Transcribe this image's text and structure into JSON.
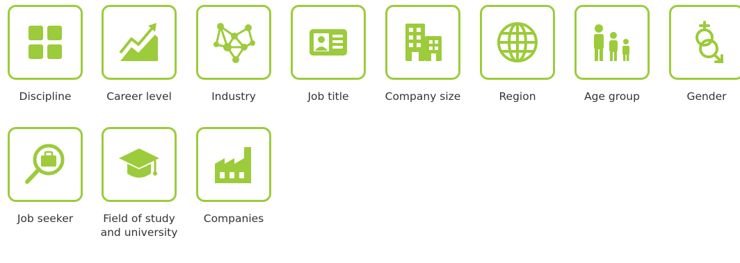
{
  "colors": {
    "accent": "#9ccb3b",
    "text": "#333333",
    "background": "#ffffff"
  },
  "filters": [
    {
      "label": "Discipline",
      "icon": "grid-icon"
    },
    {
      "label": "Career level",
      "icon": "trend-up-chart-icon"
    },
    {
      "label": "Industry",
      "icon": "network-nodes-icon"
    },
    {
      "label": "Job title",
      "icon": "id-card-icon"
    },
    {
      "label": "Company size",
      "icon": "buildings-icon"
    },
    {
      "label": "Region",
      "icon": "globe-icon"
    },
    {
      "label": "Age group",
      "icon": "people-family-icon"
    },
    {
      "label": "Gender",
      "icon": "gender-symbols-icon"
    },
    {
      "label": "Job seeker",
      "icon": "magnifier-briefcase-icon"
    },
    {
      "label": "Field of study and university",
      "icon": "graduation-cap-icon"
    },
    {
      "label": "Companies",
      "icon": "factory-icon"
    }
  ]
}
